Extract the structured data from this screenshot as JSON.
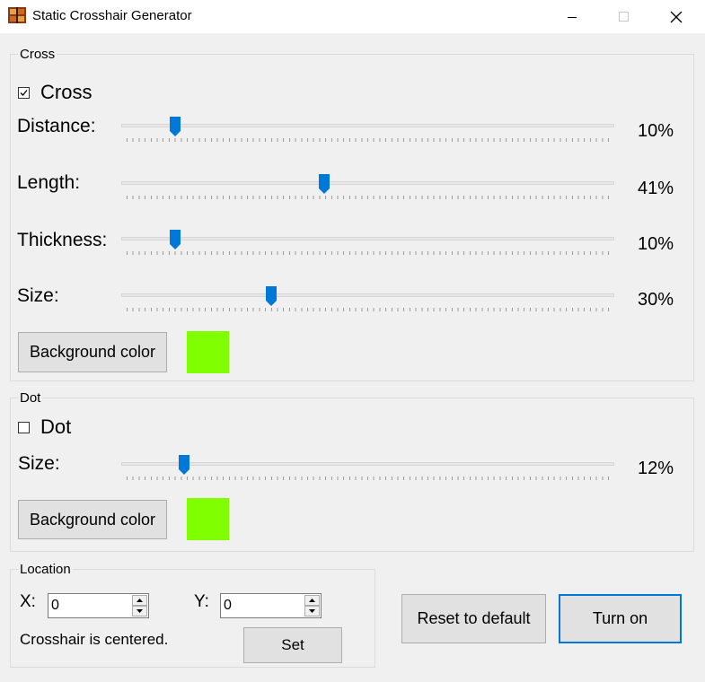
{
  "window": {
    "title": "Static Crosshair Generator",
    "icon": "crosshair-app-icon"
  },
  "cross": {
    "group_label": "Cross",
    "checkbox_label": "Cross",
    "checked": true,
    "distance": {
      "label": "Distance:",
      "value": 10,
      "value_text": "10%"
    },
    "length": {
      "label": "Length:",
      "value": 41,
      "value_text": "41%"
    },
    "thickness": {
      "label": "Thickness:",
      "value": 10,
      "value_text": "10%"
    },
    "size": {
      "label": "Size:",
      "value": 30,
      "value_text": "30%"
    },
    "bg_button_label": "Background color",
    "color": "#80ff00"
  },
  "dot": {
    "group_label": "Dot",
    "checkbox_label": "Dot",
    "checked": false,
    "size": {
      "label": "Size:",
      "value": 12,
      "value_text": "12%"
    },
    "bg_button_label": "Background color",
    "color": "#80ff00"
  },
  "location": {
    "group_label": "Location",
    "x_label": "X:",
    "x_value": "0",
    "y_label": "Y:",
    "y_value": "0",
    "status": "Crosshair is centered.",
    "set_label": "Set"
  },
  "actions": {
    "reset_label": "Reset to default",
    "turn_on_label": "Turn on"
  },
  "colors": {
    "accent": "#0078d7",
    "swatch": "#80ff00"
  }
}
